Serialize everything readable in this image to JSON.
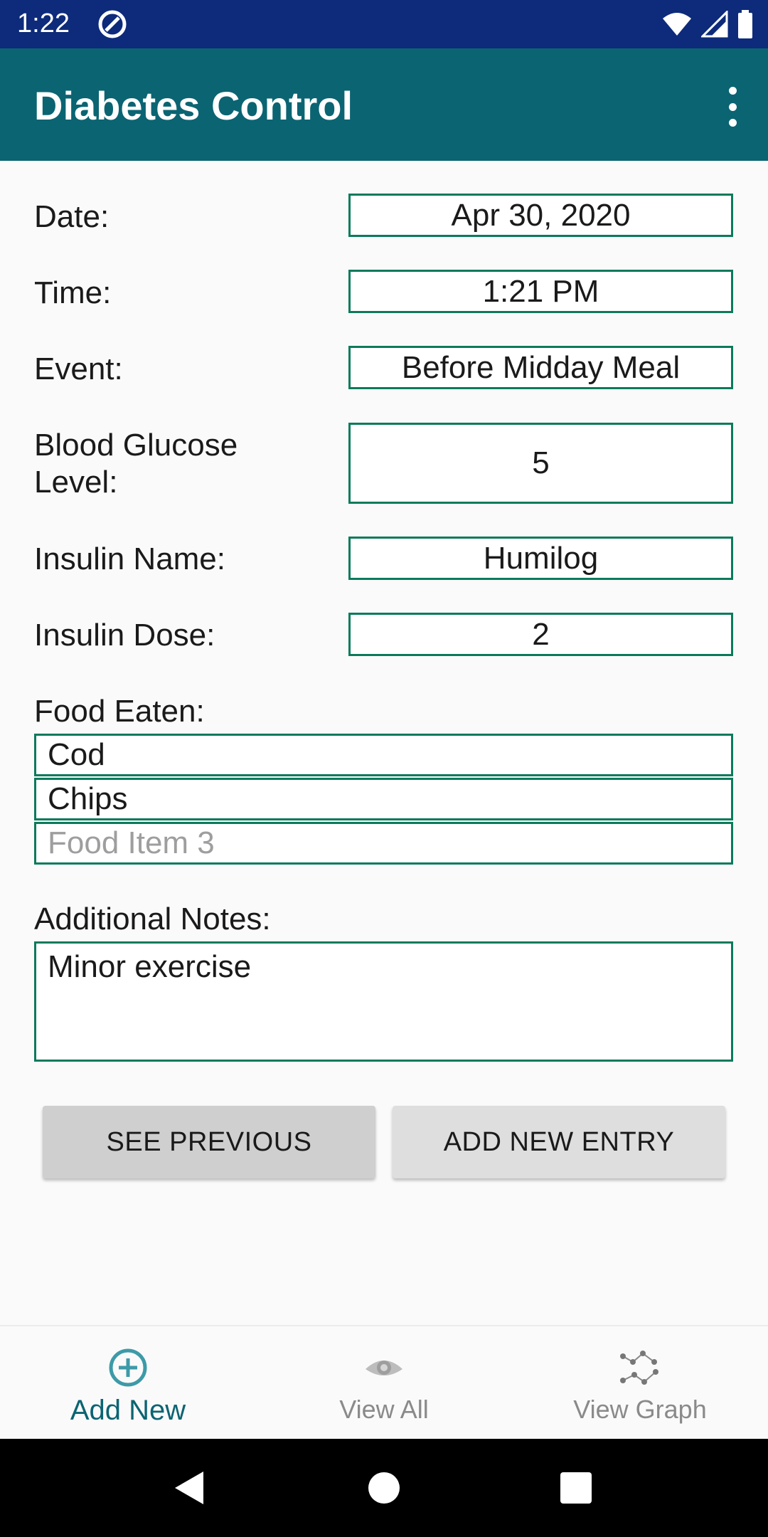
{
  "status_bar": {
    "time": "1:22"
  },
  "app_bar": {
    "title": "Diabetes Control"
  },
  "form": {
    "date_label": "Date:",
    "date_value": "Apr 30, 2020",
    "time_label": "Time:",
    "time_value": "1:21 PM",
    "event_label": "Event:",
    "event_value": "Before Midday Meal",
    "glucose_label_line1": "Blood Glucose",
    "glucose_label_line2": "Level:",
    "glucose_value": "5",
    "insulin_name_label": "Insulin Name:",
    "insulin_name_value": "Humilog",
    "insulin_dose_label": "Insulin Dose:",
    "insulin_dose_value": "2",
    "food_label": "Food Eaten:",
    "food_items": [
      {
        "value": "Cod",
        "placeholder": ""
      },
      {
        "value": "Chips",
        "placeholder": ""
      },
      {
        "value": "",
        "placeholder": "Food Item 3"
      }
    ],
    "notes_label": "Additional Notes:",
    "notes_value": "Minor exercise"
  },
  "buttons": {
    "see_previous": "SEE PREVIOUS",
    "add_new_entry": "ADD NEW ENTRY"
  },
  "bottom_nav": {
    "items": [
      {
        "label": "Add New",
        "icon": "add-circle-icon",
        "active": true
      },
      {
        "label": "View All",
        "icon": "eye-icon",
        "active": false
      },
      {
        "label": "View Graph",
        "icon": "graph-icon",
        "active": false
      }
    ]
  },
  "colors": {
    "status_bar": "#0d2b7a",
    "app_bar": "#0b6472",
    "field_border": "#0b7a5b",
    "active_nav": "#0b6472"
  }
}
